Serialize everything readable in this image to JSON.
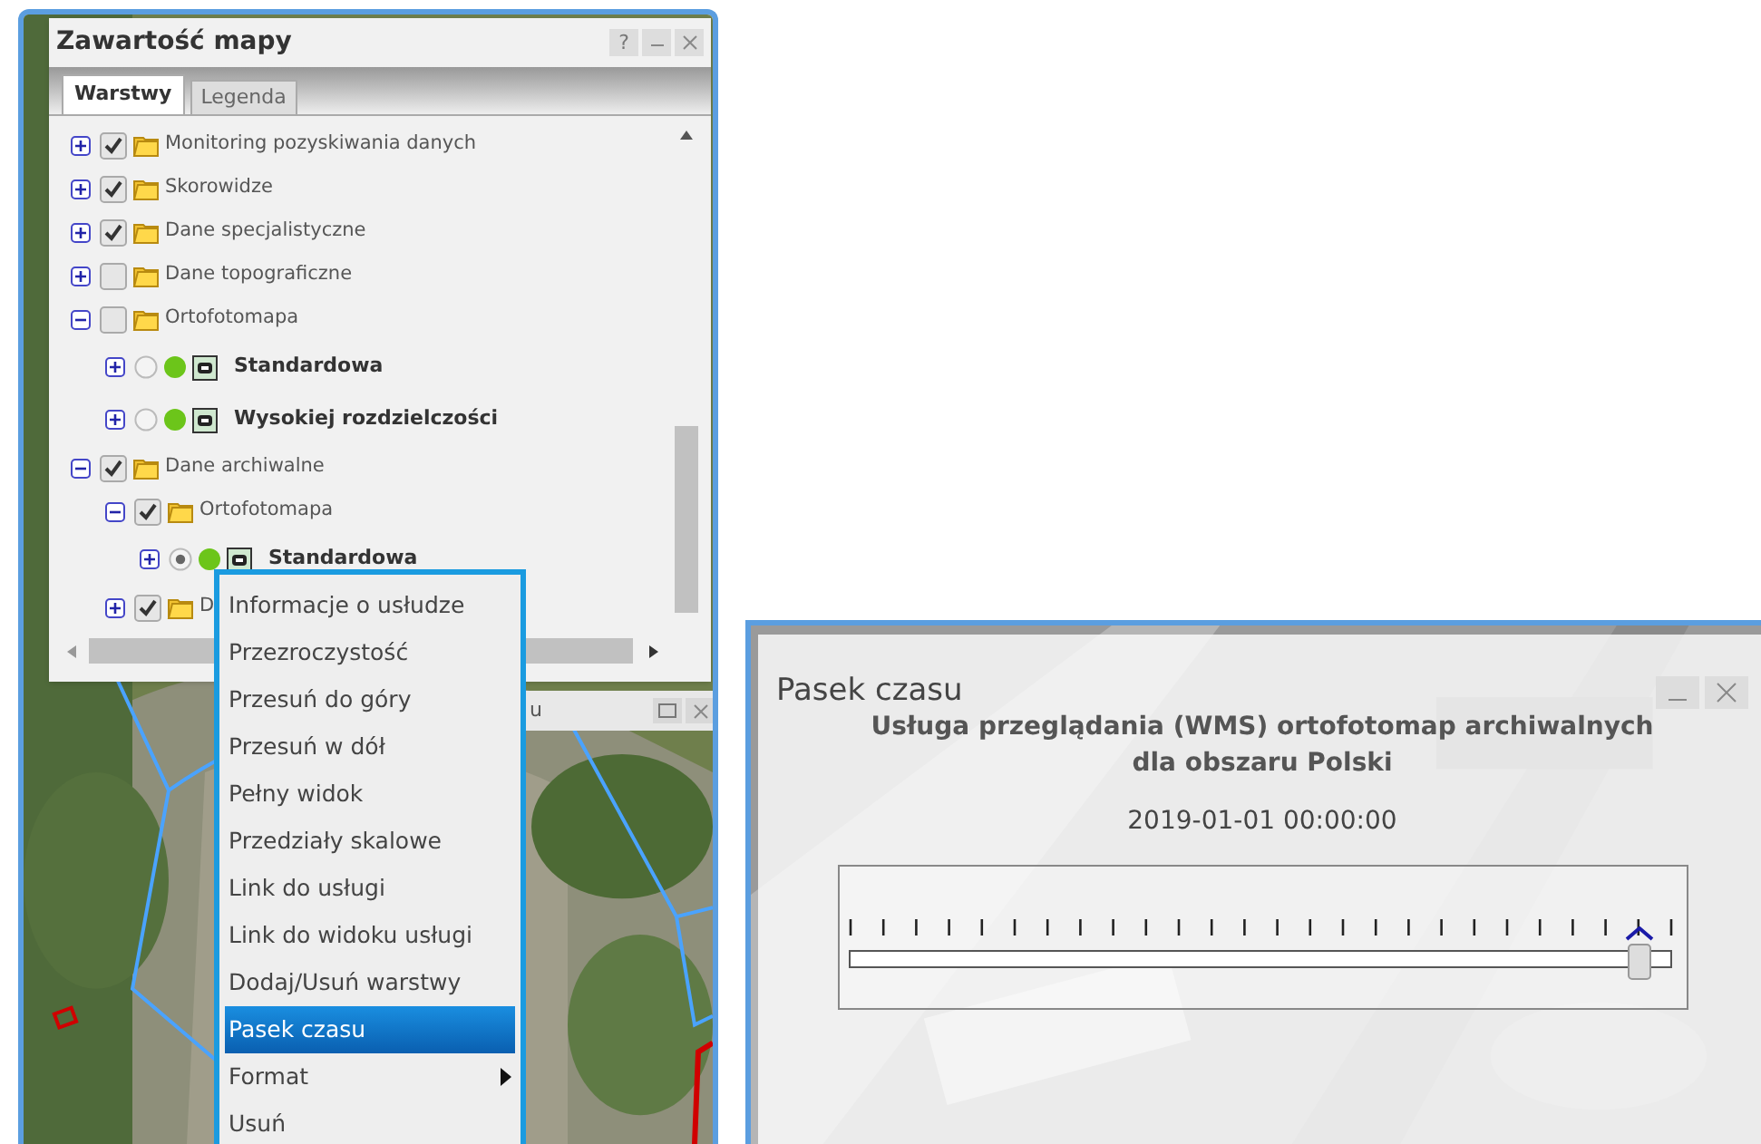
{
  "map_contents": {
    "title": "Zawartość mapy",
    "help": "?",
    "tabs": [
      {
        "label": "Warstwy",
        "selected": true
      },
      {
        "label": "Legenda",
        "selected": false
      }
    ],
    "layers": [
      {
        "kind": "folder",
        "label": "Monitoring pozyskiwania danych",
        "expanded": false,
        "checked": true
      },
      {
        "kind": "folder",
        "label": "Skorowidze",
        "expanded": false,
        "checked": true
      },
      {
        "kind": "folder",
        "label": "Dane specjalistyczne",
        "expanded": false,
        "checked": true
      },
      {
        "kind": "folder",
        "label": "Dane topograficzne",
        "expanded": false,
        "checked": false
      },
      {
        "kind": "folder",
        "label": "Ortofotomapa",
        "expanded": true,
        "checked": false,
        "children": [
          {
            "kind": "service",
            "label": "Standardowa",
            "expanded": false,
            "selected": false
          },
          {
            "kind": "service",
            "label": "Wysokiej rozdzielczości",
            "expanded": false,
            "selected": false
          }
        ]
      },
      {
        "kind": "folder",
        "label": "Dane archiwalne",
        "expanded": true,
        "checked": true,
        "children": [
          {
            "kind": "folder",
            "label": "Ortofotomapa",
            "expanded": true,
            "checked": true,
            "children": [
              {
                "kind": "service",
                "label": "Standardowa",
                "expanded": false,
                "selected": true
              }
            ]
          },
          {
            "kind": "folder",
            "label": "D",
            "expanded": false,
            "checked": true
          }
        ]
      }
    ]
  },
  "background_window": {
    "title": "u"
  },
  "context_menu": [
    {
      "label": "Informacje o usłudze",
      "selected": false,
      "submenu": false
    },
    {
      "label": "Przezroczystość",
      "selected": false,
      "submenu": false
    },
    {
      "label": "Przesuń do góry",
      "selected": false,
      "submenu": false
    },
    {
      "label": "Przesuń w dół",
      "selected": false,
      "submenu": false
    },
    {
      "label": "Pełny widok",
      "selected": false,
      "submenu": false
    },
    {
      "label": "Przedziały skalowe",
      "selected": false,
      "submenu": false
    },
    {
      "label": "Link do usługi",
      "selected": false,
      "submenu": false
    },
    {
      "label": "Link do widoku usługi",
      "selected": false,
      "submenu": false
    },
    {
      "label": "Dodaj/Usuń warstwy",
      "selected": false,
      "submenu": false
    },
    {
      "label": "Pasek czasu",
      "selected": true,
      "submenu": false
    },
    {
      "label": "Format",
      "selected": false,
      "submenu": true
    },
    {
      "label": "Usuń",
      "selected": false,
      "submenu": false
    }
  ],
  "time_bar": {
    "title": "Pasek czasu",
    "description": "Usługa przeglądania (WMS) ortofotomap archiwalnych dla obszaru Polski",
    "date": "2019-01-01 00:00:00",
    "level": 0.96
  }
}
